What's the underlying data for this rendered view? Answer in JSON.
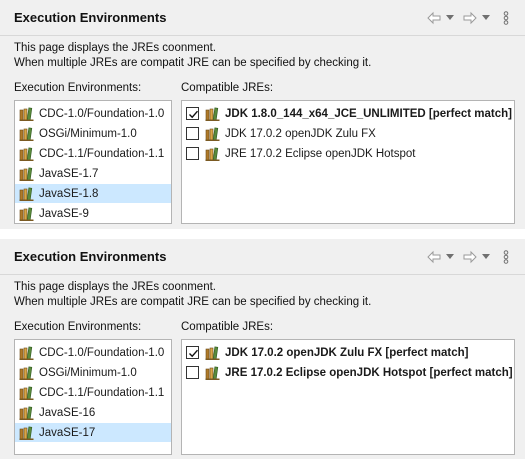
{
  "panels": [
    {
      "title": "Execution Environments",
      "description_line1": "This page displays the JREs coonment.",
      "description_line2": "When multiple JREs are compatit JRE can be specified by checking it.",
      "env_label": "Execution Environments:",
      "jre_label": "Compatible JREs:",
      "environments": [
        {
          "label": "CDC-1.0/Foundation-1.0",
          "selected": false
        },
        {
          "label": "OSGi/Minimum-1.0",
          "selected": false
        },
        {
          "label": "CDC-1.1/Foundation-1.1",
          "selected": false
        },
        {
          "label": "JavaSE-1.7",
          "selected": false
        },
        {
          "label": "JavaSE-1.8",
          "selected": true
        },
        {
          "label": "JavaSE-9",
          "selected": false
        }
      ],
      "jres": [
        {
          "label": "JDK 1.8.0_144_x64_JCE_UNLIMITED [perfect match]",
          "checked": true,
          "bold": true
        },
        {
          "label": "JDK 17.0.2 openJDK Zulu FX",
          "checked": false,
          "bold": false
        },
        {
          "label": "JRE 17.0.2 Eclipse openJDK Hotspot",
          "checked": false,
          "bold": false
        }
      ]
    },
    {
      "title": "Execution Environments",
      "description_line1": "This page displays the JREs coonment.",
      "description_line2": "When multiple JREs are compatit JRE can be specified by checking it.",
      "env_label": "Execution Environments:",
      "jre_label": "Compatible JREs:",
      "environments": [
        {
          "label": "CDC-1.0/Foundation-1.0",
          "selected": false
        },
        {
          "label": "OSGi/Minimum-1.0",
          "selected": false
        },
        {
          "label": "CDC-1.1/Foundation-1.1",
          "selected": false
        },
        {
          "label": "JavaSE-16",
          "selected": false
        },
        {
          "label": "JavaSE-17",
          "selected": true
        }
      ],
      "jres": [
        {
          "label": "JDK 17.0.2 openJDK Zulu FX [perfect match]",
          "checked": true,
          "bold": true
        },
        {
          "label": "JRE 17.0.2 Eclipse openJDK Hotspot [perfect match]",
          "checked": false,
          "bold": true
        }
      ]
    }
  ],
  "toolbar": {
    "icons": [
      "back-arrow-icon",
      "dropdown-icon",
      "forward-arrow-icon",
      "dropdown-icon",
      "view-menu-icon"
    ]
  },
  "colors": {
    "background": "#f0f0f0",
    "selection": "#cce8ff",
    "list_border": "#b4b4b4",
    "icon_book": "#8a6a2a",
    "icon_accent": "#3c8a3c"
  }
}
